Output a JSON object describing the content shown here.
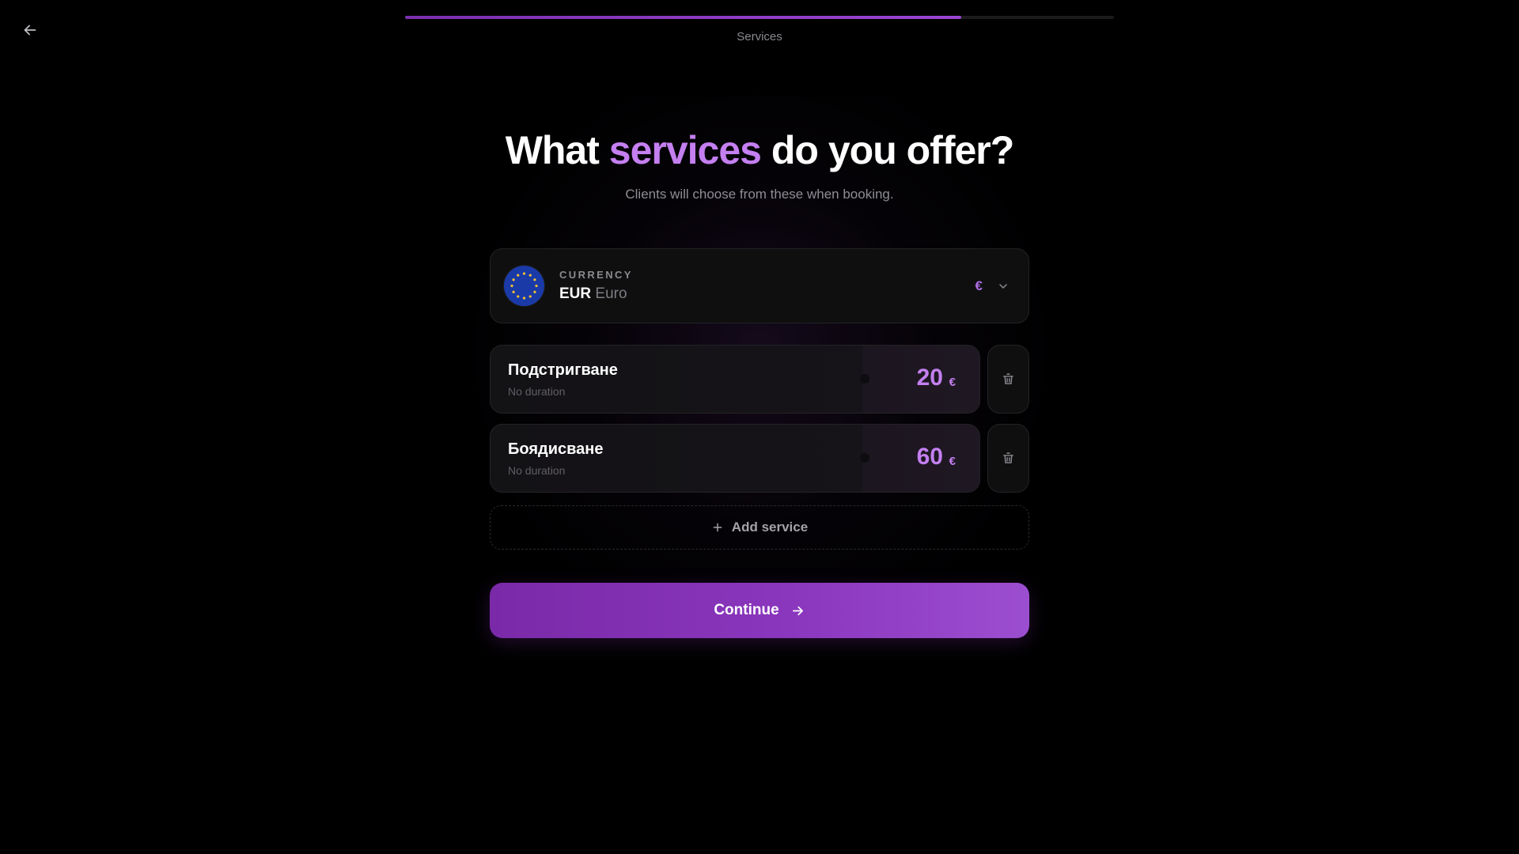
{
  "progress": {
    "step_label": "Services",
    "fraction": 0.785
  },
  "header": {
    "title_prefix": "What ",
    "title_accent": "services",
    "title_suffix": " do you offer?",
    "subtitle": "Clients will choose from these when booking."
  },
  "currency": {
    "caption": "CURRENCY",
    "code": "EUR",
    "name": "Euro",
    "symbol": "€",
    "flag_icon": "eu-flag-icon"
  },
  "services": [
    {
      "name": "Подстригване",
      "duration": "No duration",
      "price": "20",
      "currency": "€"
    },
    {
      "name": "Боядисване",
      "duration": "No duration",
      "price": "60",
      "currency": "€"
    }
  ],
  "add_service_label": "Add service",
  "continue_label": "Continue",
  "colors": {
    "accent": "#c47ff0",
    "button_start": "#7a2aa8",
    "button_end": "#9c4ed0",
    "background": "#000000"
  }
}
